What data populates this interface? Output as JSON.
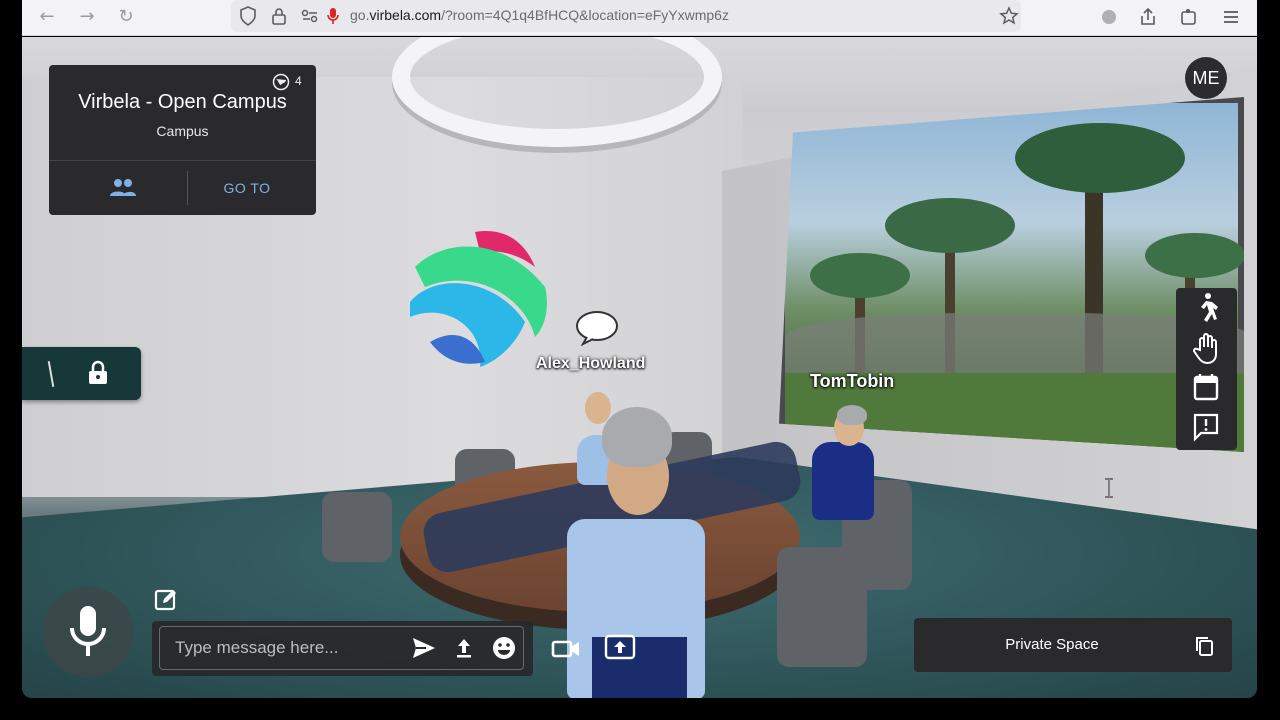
{
  "browser": {
    "url_prefix": "go.",
    "url_domain": "virbela.com",
    "url_rest": "/?room=4Q1q4BfHCQ&location=eFyYxwmp6z"
  },
  "room_card": {
    "title": "Virbela - Open Campus",
    "subtitle": "Campus",
    "online_count": "4",
    "goto_label": "GO TO",
    "people_icon": "people-icon",
    "globe_icon": "globe-icon"
  },
  "lock_panel": {
    "icon": "lock-icon"
  },
  "me_button": {
    "label": "ME"
  },
  "right_toolbar": {
    "items": [
      {
        "name": "walk",
        "icon": "walk-icon"
      },
      {
        "name": "raise-hand",
        "icon": "hand-icon"
      },
      {
        "name": "calendar",
        "icon": "calendar-icon"
      },
      {
        "name": "feedback",
        "icon": "feedback-icon"
      }
    ]
  },
  "scene": {
    "avatars": [
      {
        "name": "Alex_Howland"
      },
      {
        "name": "TomTobin"
      }
    ]
  },
  "chat": {
    "placeholder": "Type message here...",
    "send_icon": "send-icon",
    "upload_icon": "upload-icon",
    "emoji_icon": "emoji-icon"
  },
  "bottom_controls": {
    "mic_icon": "microphone-icon",
    "edit_icon": "edit-icon",
    "video_icon": "video-camera-icon",
    "share_icon": "screen-share-icon"
  },
  "private_space": {
    "label": "Private Space",
    "copy_icon": "copy-icon"
  },
  "colors": {
    "panel_bg": "#2a2a2c",
    "accent_blue": "#7fb1e8",
    "lock_panel_bg": "#173838"
  }
}
